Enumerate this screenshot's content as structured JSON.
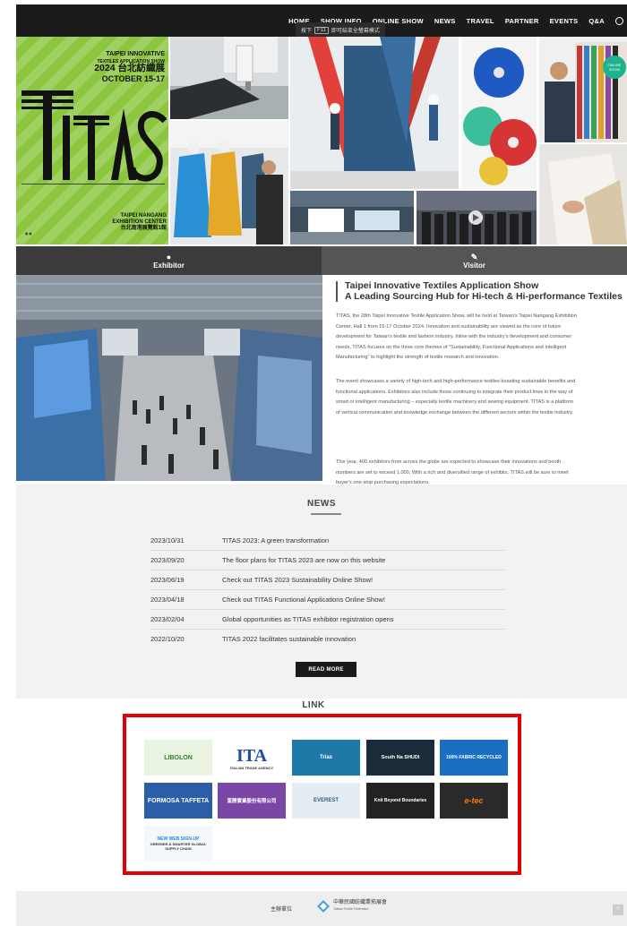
{
  "nav": {
    "items": [
      "HOME",
      "SHOW INFO",
      "ONLINE SHOW",
      "NEWS",
      "TRAVEL",
      "PARTNER",
      "EVENTS",
      "Q&A"
    ],
    "globe_icon": "globe-icon",
    "f11_tip": {
      "pre": "按下",
      "key": "F11",
      "post": "即可結束全螢幕模式"
    }
  },
  "poster": {
    "line1": "TAIPEI INNOVATIVE",
    "line2": "TEXTILES APPLICATION SHOW",
    "line3": "2024 台北紡織展",
    "line4": "OCTOBER 15-17",
    "logo": "TITAS",
    "venue1": "TAIPEI NANGANG",
    "venue2": "EXHIBITION CENTER",
    "venue3": "台北南港展覽館1館",
    "online_badge": "ONLINE SHOW"
  },
  "tabs": [
    {
      "label": "Exhibitor",
      "icon": "user-icon"
    },
    {
      "label": "Visitor",
      "icon": "pencil-icon"
    }
  ],
  "about": {
    "title1": "Taipei Innovative Textiles Application Show",
    "title2": "A Leading Sourcing Hub for Hi-tech & Hi-performance Textiles",
    "p1": [
      "TITAS, the 28th Taipei Innovative Textile Application Show, will be held at Taiwan's Taipei Nangang Exhibition",
      "Center, Hall 1 from 15-17 October 2024. Innovation and sustainability are viewed as the core of future",
      "development for Taiwan's textile and fashion industry. Inline with the industry's development and consumer",
      "needs, TITAS focuses on the three core themes of \"Sustainability, Functional Applications and Intelligent",
      "Manufacturing\" to highlight the strength of textile research and innovation."
    ],
    "p2": [
      "The event showcases a variety of high-tech and high-performance textiles boasting sustainable benefits and",
      "functional applications. Exhibitors also include those continuing to integrate their product lines in the way of",
      "smart or intelligent manufacturing – especially textile machinery and sewing equipment. TITAS is a platform",
      "of vertical communication and knowledge exchange between the different sectors within the textile industry."
    ],
    "p3": [
      "This year, 400 exhibitors from across the globe are expected to showcase their innovations and booth",
      "numbers are set to exceed 1,000. With a rich and diversified range of exhibits, TITAS will be sure to meet",
      "buyer's one-stop purchasing expectations."
    ]
  },
  "news": {
    "heading": "NEWS",
    "items": [
      {
        "date": "2023/10/31",
        "title": "TITAS 2023: A green transformation"
      },
      {
        "date": "2023/09/20",
        "title": "The floor plans for TITAS 2023 are now on this website"
      },
      {
        "date": "2023/06/19",
        "title": "Check out TITAS 2023 Sustainability Online Show!"
      },
      {
        "date": "2023/04/18",
        "title": "Check out TITAS Functional Applications Online Show!"
      },
      {
        "date": "2023/02/04",
        "title": "Global opportunities as TITAS exhibitor registration opens"
      },
      {
        "date": "2022/10/20",
        "title": "TITAS 2022 facilitates sustainable innovation"
      }
    ],
    "read_more": "READ MORE"
  },
  "links": {
    "heading": "LINK",
    "logos": [
      {
        "text": "LIBOLON",
        "bg": "#e9f3e2",
        "fg": "#2e7d32"
      },
      {
        "text": "ITA",
        "sub": "ITALIAN TRADE AGENCY",
        "bg": "#ffffff",
        "fg": "#1f4e9c"
      },
      {
        "text": "Trias",
        "bg": "#1e78a8",
        "fg": "#ffffff"
      },
      {
        "text": "South Na SHUDI",
        "bg": "#1b2b3a",
        "fg": "#ffffff"
      },
      {
        "text": "100% FABRIC RECYCLED",
        "bg": "#1a6fc2",
        "fg": "#ffffff"
      },
      {
        "text": "FORMOSA TAFFETA",
        "bg": "#2c5ea8",
        "fg": "#ffffff"
      },
      {
        "text": "富勝實業股份有限公司",
        "bg": "#7a47a6",
        "fg": "#ffffff"
      },
      {
        "text": "EVEREST",
        "bg": "#e4edf3",
        "fg": "#305a80"
      },
      {
        "text": "Knit Beyond Boundaries",
        "bg": "#222222",
        "fg": "#ffffff"
      },
      {
        "text": "e-tec",
        "bg": "#2a2a2a",
        "fg": "#ff7a00"
      },
      {
        "text": "NEW WEB SIGN-UP",
        "sub": "GREENER & SMARTER GLOBAL SUPPLY CHAIN",
        "bg": "#f5f8fb",
        "fg": "#1e88e5"
      }
    ]
  },
  "footer": {
    "host_label": "主辦單位",
    "federation_cn": "中華民國紡織業拓展會",
    "federation_en": "Taiwan Textile Federation",
    "to_top": "^"
  }
}
